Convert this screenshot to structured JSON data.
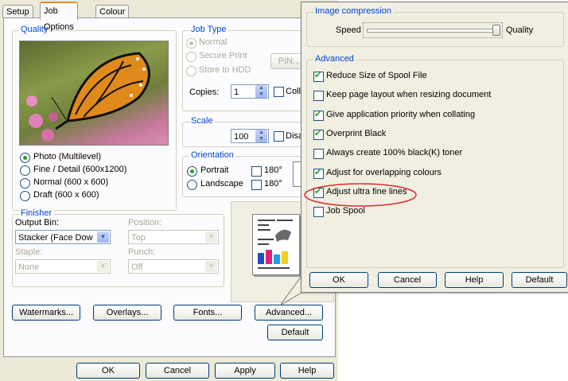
{
  "tabs": [
    "Setup",
    "Job Options",
    "Colour"
  ],
  "quality": {
    "title": "Quality",
    "options": [
      "Photo (Multilevel)",
      "Fine / Detail (600x1200)",
      "Normal (600 x 600)",
      "Draft (600 x 600)"
    ]
  },
  "job_type": {
    "title": "Job Type",
    "options": [
      "Normal",
      "Secure Print",
      "Store to HDD"
    ],
    "pin_label": "PIN...",
    "copies_label": "Copies:",
    "copies_value": "1",
    "collate_label": "Colla"
  },
  "scale": {
    "title": "Scale",
    "value": "100",
    "disable_label": "Disa"
  },
  "orientation": {
    "title": "Orientation",
    "options": [
      "Portrait",
      "Landscape"
    ],
    "rotate_labels": [
      "180°",
      "180°"
    ]
  },
  "finisher": {
    "title": "Finisher",
    "output_bin_label": "Output Bin:",
    "output_bin_value": "Stacker (Face Dow",
    "position_label": "Position:",
    "position_value": "Top",
    "staple_label": "Staple:",
    "staple_value": "None",
    "punch_label": "Punch:",
    "punch_value": "Off"
  },
  "buttons": {
    "watermarks": "Watermarks...",
    "overlays": "Overlays...",
    "fonts": "Fonts...",
    "advanced": "Advanced...",
    "default": "Default",
    "ok": "OK",
    "cancel": "Cancel",
    "apply": "Apply",
    "help": "Help"
  },
  "advanced_dialog": {
    "image_compression_title": "Image compression",
    "speed_label": "Speed",
    "quality_label": "Quality",
    "slider_value": 1.0,
    "advanced_title": "Advanced",
    "options": [
      {
        "label": "Reduce Size of Spool File",
        "checked": true
      },
      {
        "label": "Keep page layout when resizing document",
        "checked": false
      },
      {
        "label": "Give application priority when collating",
        "checked": true
      },
      {
        "label": "Overprint Black",
        "checked": true
      },
      {
        "label": "Always create 100% black(K) toner",
        "checked": false
      },
      {
        "label": "Adjust for overlapping colours",
        "checked": true
      },
      {
        "label": "Adjust ultra fine lines",
        "checked": true
      },
      {
        "label": "Job Spool",
        "checked": false
      }
    ],
    "buttons": {
      "ok": "OK",
      "cancel": "Cancel",
      "help": "Help",
      "default": "Default"
    }
  },
  "colors": {
    "highlight_ellipse": "#e0282e",
    "group_title": "#0046d5"
  }
}
